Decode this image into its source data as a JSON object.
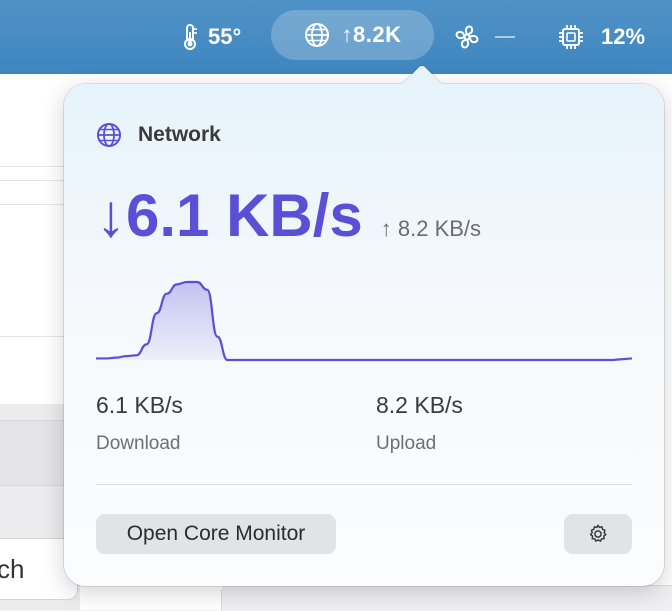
{
  "menubar": {
    "temperature": "55°",
    "network": "↑8.2K",
    "fan": "",
    "cpu": "12%"
  },
  "background": {
    "field_text": "ch"
  },
  "popover": {
    "title": "Network",
    "download_big": "↓6.1 KB/s",
    "upload_small": "↑ 8.2 KB/s",
    "download_value": "6.1 KB/s",
    "download_label": "Download",
    "upload_value": "8.2 KB/s",
    "upload_label": "Upload",
    "open_button": "Open Core Monitor"
  },
  "colors": {
    "accent": "#5a50d6",
    "menubar": "#4589c2"
  },
  "chart_data": {
    "type": "area",
    "values": [
      0.02,
      0.02,
      0.03,
      0.05,
      0.06,
      0.2,
      0.6,
      0.85,
      0.97,
      1.0,
      1.0,
      0.9,
      0.3,
      0.0,
      0.0,
      0.0,
      0.0,
      0.0,
      0.0,
      0.0,
      0.0,
      0.0,
      0.0,
      0.0,
      0.0,
      0.0,
      0.0,
      0.0,
      0.0,
      0.0,
      0.0,
      0.0,
      0.0,
      0.0,
      0.0,
      0.0,
      0.0,
      0.0,
      0.0,
      0.0,
      0.0,
      0.0,
      0.0,
      0.0,
      0.0,
      0.0,
      0.0,
      0.0,
      0.0,
      0.0,
      0.0,
      0.0,
      0.01,
      0.02
    ],
    "color": "#5a50d6"
  }
}
